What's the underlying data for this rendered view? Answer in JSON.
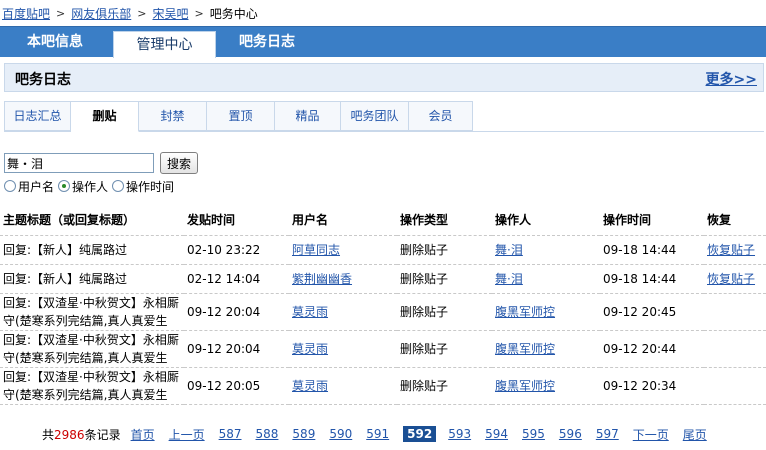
{
  "breadcrumb": {
    "items": [
      "百度贴吧",
      "网友俱乐部",
      "宋吴吧"
    ],
    "current": "吧务中心",
    "separator": ">"
  },
  "main_tabs": [
    {
      "label": "本吧信息",
      "active": false
    },
    {
      "label": "管理中心",
      "active": true
    },
    {
      "label": "吧务日志",
      "active": false
    }
  ],
  "section": {
    "title": "吧务日志",
    "more_label": "更多>>"
  },
  "sub_tabs": [
    {
      "label": "日志汇总",
      "active": false
    },
    {
      "label": "删贴",
      "active": true
    },
    {
      "label": "封禁",
      "active": false
    },
    {
      "label": "置顶",
      "active": false
    },
    {
      "label": "精品",
      "active": false
    },
    {
      "label": "吧务团队",
      "active": false
    },
    {
      "label": "会员",
      "active": false
    }
  ],
  "search": {
    "value": "舞・泪",
    "button_label": "搜索",
    "options": [
      {
        "label": "用户名",
        "checked": false
      },
      {
        "label": "操作人",
        "checked": true
      },
      {
        "label": "操作时间",
        "checked": false
      }
    ]
  },
  "table": {
    "headers": [
      "主题标题（或回复标题）",
      "发贴时间",
      "用户名",
      "操作类型",
      "操作人",
      "操作时间",
      "恢复"
    ],
    "rows": [
      {
        "title": "回复:【新人】纯属路过",
        "post_time": "02-10 23:22",
        "user": "阿草同志",
        "action": "删除贴子",
        "operator": "舞·泪",
        "op_time": "09-18 14:44",
        "restore": "恢复贴子"
      },
      {
        "title": "回复:【新人】纯属路过",
        "post_time": "02-12 14:04",
        "user": "紫荆幽幽香",
        "action": "删除贴子",
        "operator": "舞·泪",
        "op_time": "09-18 14:44",
        "restore": "恢复贴子"
      },
      {
        "title": "回复:【双渣星·中秋贺文】永相厮守(楚寒系列完结篇,真人真爱生",
        "post_time": "09-12 20:04",
        "user": "莫灵雨",
        "action": "删除贴子",
        "operator": "腹黑军师控",
        "op_time": "09-12 20:45",
        "restore": ""
      },
      {
        "title": "回复:【双渣星·中秋贺文】永相厮守(楚寒系列完结篇,真人真爱生",
        "post_time": "09-12 20:04",
        "user": "莫灵雨",
        "action": "删除贴子",
        "operator": "腹黑军师控",
        "op_time": "09-12 20:44",
        "restore": ""
      },
      {
        "title": "回复:【双渣星·中秋贺文】永相厮守(楚寒系列完结篇,真人真爱生",
        "post_time": "09-12 20:05",
        "user": "莫灵雨",
        "action": "删除贴子",
        "operator": "腹黑军师控",
        "op_time": "09-12 20:34",
        "restore": ""
      }
    ]
  },
  "pagination": {
    "total_prefix": "共",
    "total_count": "2986",
    "total_suffix": "条记录",
    "first": "首页",
    "prev": "上一页",
    "pages": [
      "587",
      "588",
      "589",
      "590",
      "591",
      "592",
      "593",
      "594",
      "595",
      "596",
      "597"
    ],
    "current_page": "592",
    "next": "下一页",
    "last": "尾页"
  },
  "colors": {
    "tab_bar": "#3a7ec6",
    "link": "#2255aa",
    "current_page_bg": "#1a4f94",
    "count_red": "#cc0000"
  }
}
